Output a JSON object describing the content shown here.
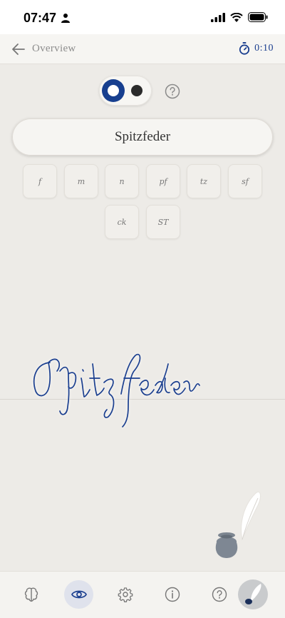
{
  "status_bar": {
    "time": "07:47"
  },
  "nav": {
    "back_label": "Overview",
    "timer": "0:10"
  },
  "mode_toggle": {
    "state": "on"
  },
  "pen_button": {
    "label": "Spitzfeder"
  },
  "glyph_tiles": [
    {
      "glyph": "f"
    },
    {
      "glyph": "m"
    },
    {
      "glyph": "n"
    },
    {
      "glyph": "pf"
    },
    {
      "glyph": "tz"
    },
    {
      "glyph": "sf"
    },
    {
      "glyph": "ck"
    },
    {
      "glyph": "ST"
    }
  ],
  "canvas": {
    "script_text": "Spitzfeder"
  },
  "tabs": [
    {
      "icon": "brain-icon"
    },
    {
      "icon": "eye-icon",
      "active": true
    },
    {
      "icon": "gear-icon"
    },
    {
      "icon": "info-icon"
    },
    {
      "icon": "help-icon"
    },
    {
      "icon": "quill-avatar-icon"
    }
  ],
  "colors": {
    "accent": "#173f8f",
    "background": "#edebe7",
    "ink": "#1b3f8f"
  }
}
